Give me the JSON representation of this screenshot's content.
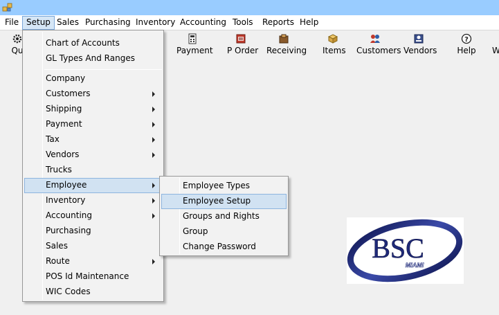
{
  "colors": {
    "titlebar": "#99ccff",
    "menu_highlight": "#d1e2f2",
    "logo_blue": "#1f2a7a"
  },
  "menubar": {
    "items": [
      "File",
      "Setup",
      "Sales",
      "Purchasing",
      "Inventory",
      "Accounting",
      "Tools",
      "Reports",
      "Help"
    ],
    "active": "Setup"
  },
  "toolbar": {
    "items": [
      {
        "label": "Qu",
        "icon": "gear-icon"
      },
      {
        "label": "Payment",
        "icon": "payment-icon"
      },
      {
        "label": "P Order",
        "icon": "purchase-order-icon"
      },
      {
        "label": "Receiving",
        "icon": "receiving-icon"
      },
      {
        "label": "Items",
        "icon": "items-box-icon"
      },
      {
        "label": "Customers",
        "icon": "customers-icon"
      },
      {
        "label": "Vendors",
        "icon": "vendors-icon"
      },
      {
        "label": "Help",
        "icon": "help-icon"
      },
      {
        "label": "W",
        "icon": ""
      }
    ]
  },
  "setup_menu": {
    "group1": [
      "Chart of Accounts",
      "GL Types And Ranges"
    ],
    "group2": [
      {
        "label": "Company",
        "submenu": false
      },
      {
        "label": "Customers",
        "submenu": true
      },
      {
        "label": "Shipping",
        "submenu": true
      },
      {
        "label": "Payment",
        "submenu": true
      },
      {
        "label": "Tax",
        "submenu": true
      },
      {
        "label": "Vendors",
        "submenu": true
      },
      {
        "label": "Trucks",
        "submenu": false
      },
      {
        "label": "Employee",
        "submenu": true
      },
      {
        "label": "Inventory",
        "submenu": true
      },
      {
        "label": "Accounting",
        "submenu": true
      },
      {
        "label": "Purchasing",
        "submenu": false
      },
      {
        "label": "Sales",
        "submenu": false
      },
      {
        "label": "Route",
        "submenu": true
      },
      {
        "label": "POS Id Maintenance",
        "submenu": false
      },
      {
        "label": "WIC Codes",
        "submenu": false
      }
    ],
    "highlighted": "Employee"
  },
  "employee_submenu": {
    "items": [
      "Employee Types",
      "Employee Setup",
      "Groups and Rights",
      "Group",
      "Change Password"
    ],
    "highlighted": "Employee Setup"
  },
  "logo": {
    "text": "BSC",
    "subtext": "MIAMI"
  }
}
